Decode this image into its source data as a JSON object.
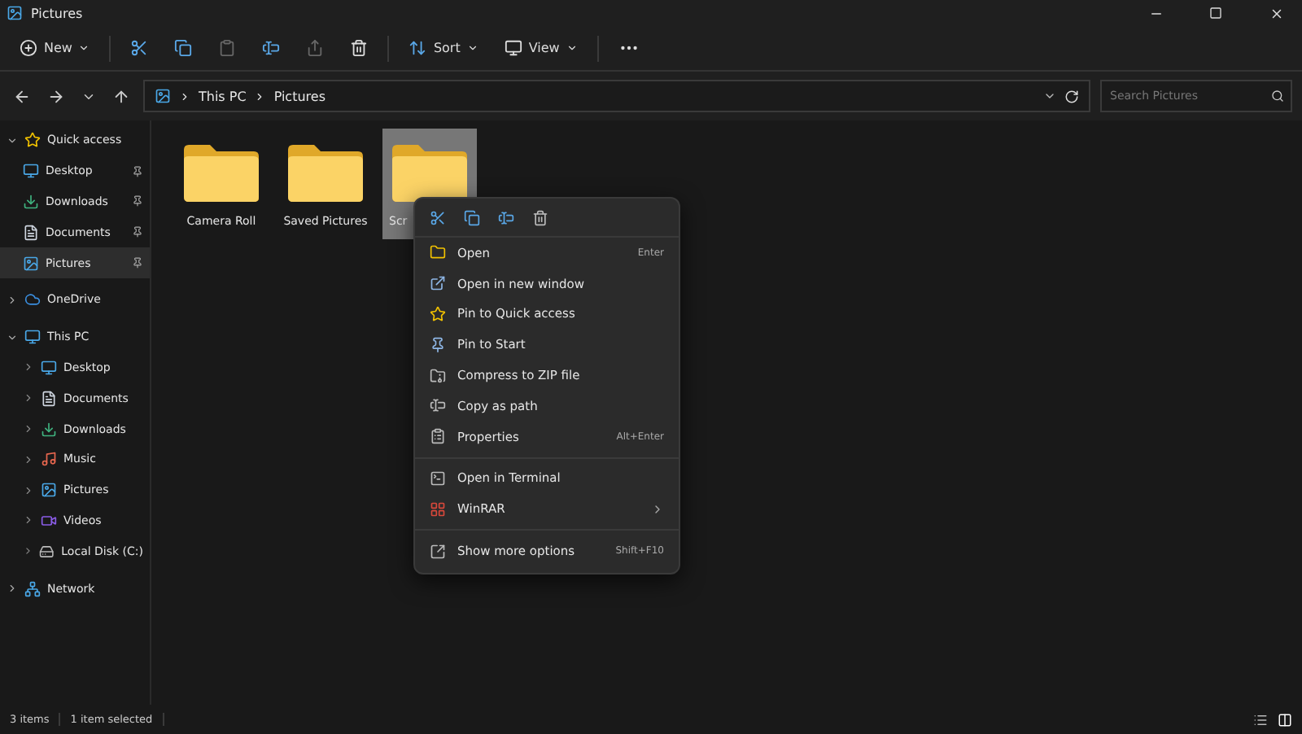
{
  "window": {
    "title": "Pictures"
  },
  "toolbar": {
    "new_label": "New",
    "sort_label": "Sort",
    "view_label": "View"
  },
  "address": {
    "path": [
      "This PC",
      "Pictures"
    ]
  },
  "search": {
    "placeholder": "Search Pictures"
  },
  "sidebar": {
    "items": [
      {
        "label": "Quick access",
        "kind": "star",
        "expanded": true,
        "selected": false,
        "children": [
          {
            "label": "Desktop",
            "kind": "desktop",
            "pinned": true,
            "selected": false
          },
          {
            "label": "Downloads",
            "kind": "download",
            "pinned": true,
            "selected": false
          },
          {
            "label": "Documents",
            "kind": "document",
            "pinned": true,
            "selected": false
          },
          {
            "label": "Pictures",
            "kind": "picture",
            "pinned": true,
            "selected": true
          }
        ]
      },
      {
        "label": "OneDrive",
        "kind": "cloud",
        "expanded": false,
        "selected": false
      },
      {
        "label": "This PC",
        "kind": "monitor",
        "expanded": true,
        "selected": false,
        "children": [
          {
            "label": "Desktop",
            "kind": "desktop",
            "pinned": false,
            "selected": false
          },
          {
            "label": "Documents",
            "kind": "document",
            "pinned": false,
            "selected": false
          },
          {
            "label": "Downloads",
            "kind": "download",
            "pinned": false,
            "selected": false
          },
          {
            "label": "Music",
            "kind": "music",
            "pinned": false,
            "selected": false
          },
          {
            "label": "Pictures",
            "kind": "picture",
            "pinned": false,
            "selected": false
          },
          {
            "label": "Videos",
            "kind": "video",
            "pinned": false,
            "selected": false
          },
          {
            "label": "Local Disk (C:)",
            "kind": "disk",
            "pinned": false,
            "selected": false
          }
        ]
      },
      {
        "label": "Network",
        "kind": "network",
        "expanded": false,
        "selected": false
      }
    ]
  },
  "files": [
    {
      "name": "Camera Roll",
      "selected": false
    },
    {
      "name": "Saved Pictures",
      "selected": false
    },
    {
      "name": "Scr",
      "selected": true
    }
  ],
  "context_menu": {
    "groups": [
      [
        {
          "label": "Open",
          "kind": "folder",
          "shortcut": "Enter"
        },
        {
          "label": "Open in new window",
          "kind": "external"
        },
        {
          "label": "Pin to Quick access",
          "kind": "star"
        },
        {
          "label": "Pin to Start",
          "kind": "pin"
        },
        {
          "label": "Compress to ZIP file",
          "kind": "zip"
        },
        {
          "label": "Copy as path",
          "kind": "path"
        },
        {
          "label": "Properties",
          "kind": "properties",
          "shortcut": "Alt+Enter"
        }
      ],
      [
        {
          "label": "Open in Terminal",
          "kind": "terminal"
        },
        {
          "label": "WinRAR",
          "kind": "winrar",
          "submenu": true
        }
      ],
      [
        {
          "label": "Show more options",
          "kind": "more",
          "shortcut": "Shift+F10"
        }
      ]
    ]
  },
  "status_bar": {
    "items": [
      "3 items",
      "1 item selected"
    ]
  }
}
